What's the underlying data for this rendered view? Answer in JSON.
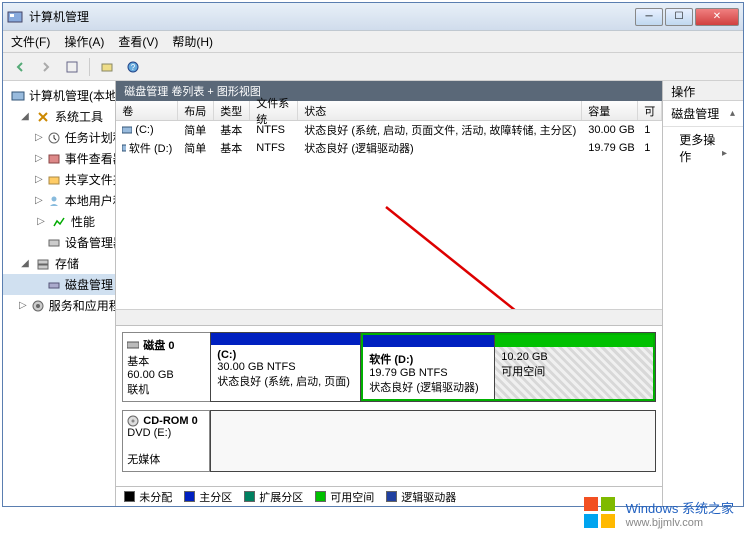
{
  "window": {
    "title": "计算机管理"
  },
  "menu": {
    "file": "文件(F)",
    "action": "操作(A)",
    "view": "查看(V)",
    "help": "帮助(H)"
  },
  "tree": {
    "root": "计算机管理(本地)",
    "system_tools": "系统工具",
    "task_scheduler": "任务计划程序",
    "event_viewer": "事件查看器",
    "shared_folders": "共享文件夹",
    "local_users": "本地用户和组",
    "performance": "性能",
    "device_manager": "设备管理器",
    "storage": "存储",
    "disk_management": "磁盘管理",
    "services_apps": "服务和应用程序"
  },
  "center_header": "磁盘管理  卷列表 + 图形视图",
  "columns": {
    "volume": "卷",
    "layout": "布局",
    "type": "类型",
    "fs": "文件系统",
    "status": "状态",
    "capacity": "容量",
    "free": "可"
  },
  "volumes": [
    {
      "name": "(C:)",
      "layout": "简单",
      "type": "基本",
      "fs": "NTFS",
      "status": "状态良好 (系统, 启动, 页面文件, 活动, 故障转储, 主分区)",
      "capacity": "30.00 GB",
      "free": "1"
    },
    {
      "name": "软件 (D:)",
      "layout": "简单",
      "type": "基本",
      "fs": "NTFS",
      "status": "状态良好 (逻辑驱动器)",
      "capacity": "19.79 GB",
      "free": "1"
    }
  ],
  "disks": [
    {
      "label": "磁盘 0",
      "type": "基本",
      "size": "60.00 GB",
      "status": "联机",
      "partitions": [
        {
          "title": "(C:)",
          "line2": "30.00 GB NTFS",
          "line3": "状态良好 (系统, 启动, 页面)",
          "header": "blue",
          "width": 150
        },
        {
          "title": "软件  (D:)",
          "line2": "19.79 GB NTFS",
          "line3": "状态良好 (逻辑驱动器)",
          "header": "blue",
          "width": 132,
          "in_extended": true
        },
        {
          "title": "",
          "line2": "10.20 GB",
          "line3": "可用空间",
          "header": "green",
          "width": 100,
          "in_extended": true,
          "pattern": true
        }
      ]
    },
    {
      "label": "CD-ROM 0",
      "type": "DVD (E:)",
      "size": "",
      "status": "无媒体",
      "partitions": []
    }
  ],
  "legend": {
    "unallocated": "未分配",
    "primary": "主分区",
    "extended": "扩展分区",
    "free": "可用空间",
    "logical": "逻辑驱动器"
  },
  "actions": {
    "header": "操作",
    "section": "磁盘管理",
    "more": "更多操作"
  },
  "watermark": {
    "line1": "Windows 系统之家",
    "line2": "www.bjjmlv.com"
  }
}
